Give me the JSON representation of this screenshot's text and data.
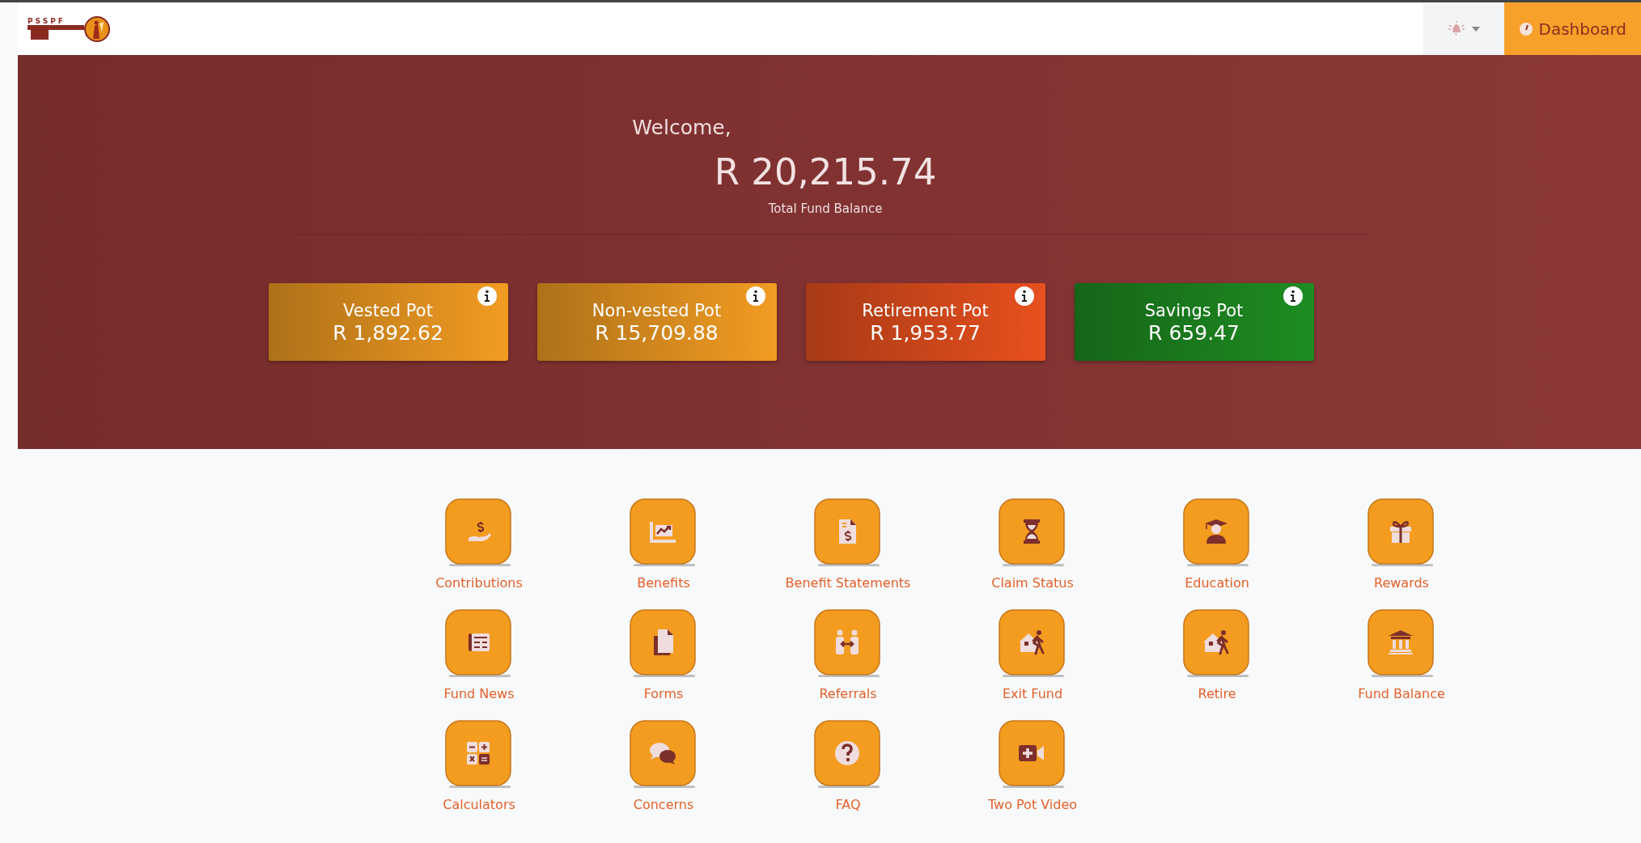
{
  "topbar": {
    "logo_text": "PSSPF",
    "dashboard_button": "Dashboard"
  },
  "hero": {
    "greeting": "Welcome,",
    "total": "R 20,215.74",
    "total_label": "Total Fund Balance",
    "pots": [
      {
        "name": "Vested Pot",
        "amount": "R 1,892.62",
        "color": "#f29c22"
      },
      {
        "name": "Non-vested Pot",
        "amount": "R 15,709.88",
        "color": "#f29c22"
      },
      {
        "name": "Retirement Pot",
        "amount": "R 1,953.77",
        "color": "#e8501e"
      },
      {
        "name": "Savings Pot",
        "amount": "R 659.47",
        "color": "#1e8c22"
      }
    ]
  },
  "menu": [
    {
      "label": "Contributions",
      "kind": "hand-coin"
    },
    {
      "label": "Benefits",
      "kind": "chart"
    },
    {
      "label": "Benefit Statements",
      "kind": "invoice"
    },
    {
      "label": "Claim Status",
      "kind": "hourglass"
    },
    {
      "label": "Education",
      "kind": "graduate"
    },
    {
      "label": "Rewards",
      "kind": "gift"
    },
    {
      "label": "Fund News",
      "kind": "newspaper"
    },
    {
      "label": "Forms",
      "kind": "copy"
    },
    {
      "label": "Referrals",
      "kind": "people"
    },
    {
      "label": "Exit Fund",
      "kind": "house-walk"
    },
    {
      "label": "Retire",
      "kind": "house-walk"
    },
    {
      "label": "Fund Balance",
      "kind": "bank"
    },
    {
      "label": "Calculators",
      "kind": "calculator"
    },
    {
      "label": "Concerns",
      "kind": "chat"
    },
    {
      "label": "FAQ",
      "kind": "question"
    },
    {
      "label": "Two Pot Video",
      "kind": "video"
    }
  ]
}
